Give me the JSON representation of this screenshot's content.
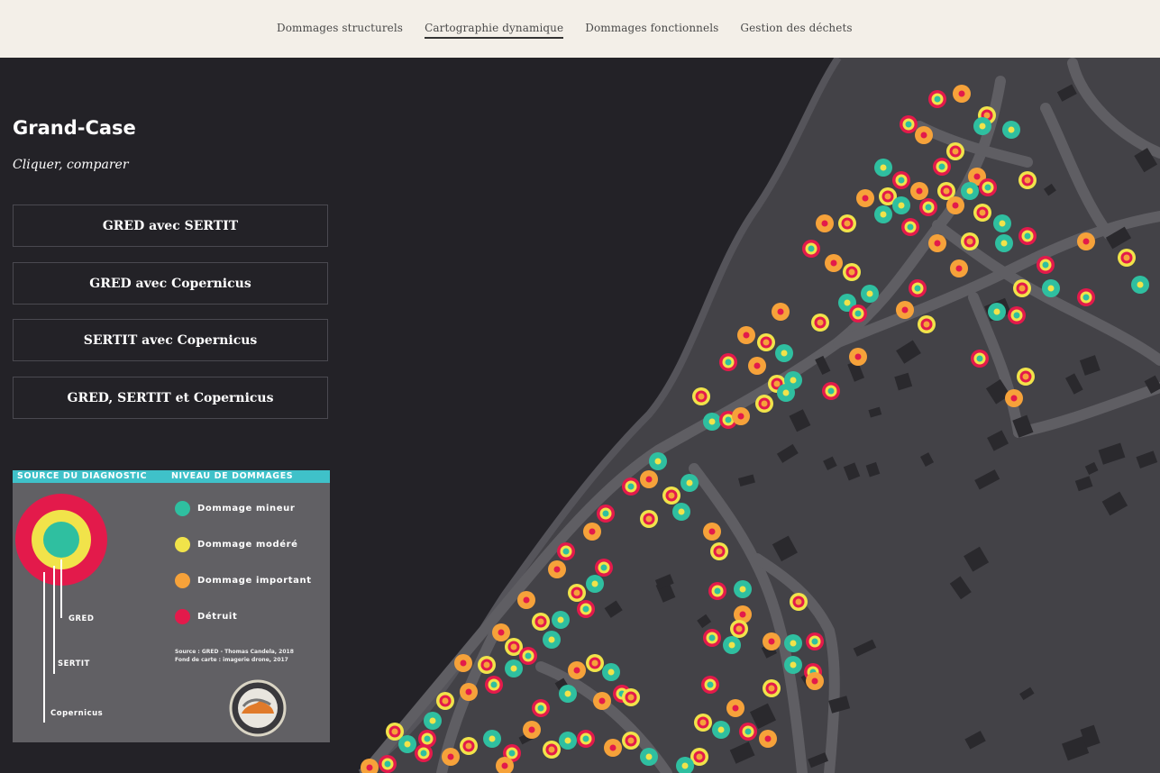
{
  "nav": {
    "tabs": [
      "Dommages structurels",
      "Cartographie dynamique",
      "Dommages fonctionnels",
      "Gestion des déchets"
    ],
    "active_index": 1
  },
  "panel": {
    "title": "Grand-Case",
    "subtitle": "Cliquer, comparer",
    "buttons": [
      "GRED avec SERTIT",
      "GRED avec Copernicus",
      "SERTIT avec Copernicus",
      "GRED, SERTIT et Copernicus"
    ]
  },
  "legend": {
    "header_left": "SOURCE DU DIAGNOSTIC",
    "header_right": "NIVEAU DE DOMMAGES",
    "levels": [
      {
        "label": "Dommage mineur",
        "color": "#2fbfa0"
      },
      {
        "label": "Dommage modéré",
        "color": "#f1e34a"
      },
      {
        "label": "Dommage important",
        "color": "#f6a23a"
      },
      {
        "label": "Détruit",
        "color": "#e31a4b"
      }
    ],
    "sources": [
      "GRED",
      "SERTIT",
      "Copernicus"
    ],
    "note_line1": "Source : GRED - Thomas Candela, 2018",
    "note_line2": "Fond de carte : imagerie drone, 2017"
  },
  "colors": {
    "land": "#434247",
    "sea": "#232227",
    "road": "#5f5e63",
    "building": "#2a292d",
    "mineur": "#2fbfa0",
    "modere": "#f1e34a",
    "important": "#f6a23a",
    "detruit": "#e31a4b"
  }
}
